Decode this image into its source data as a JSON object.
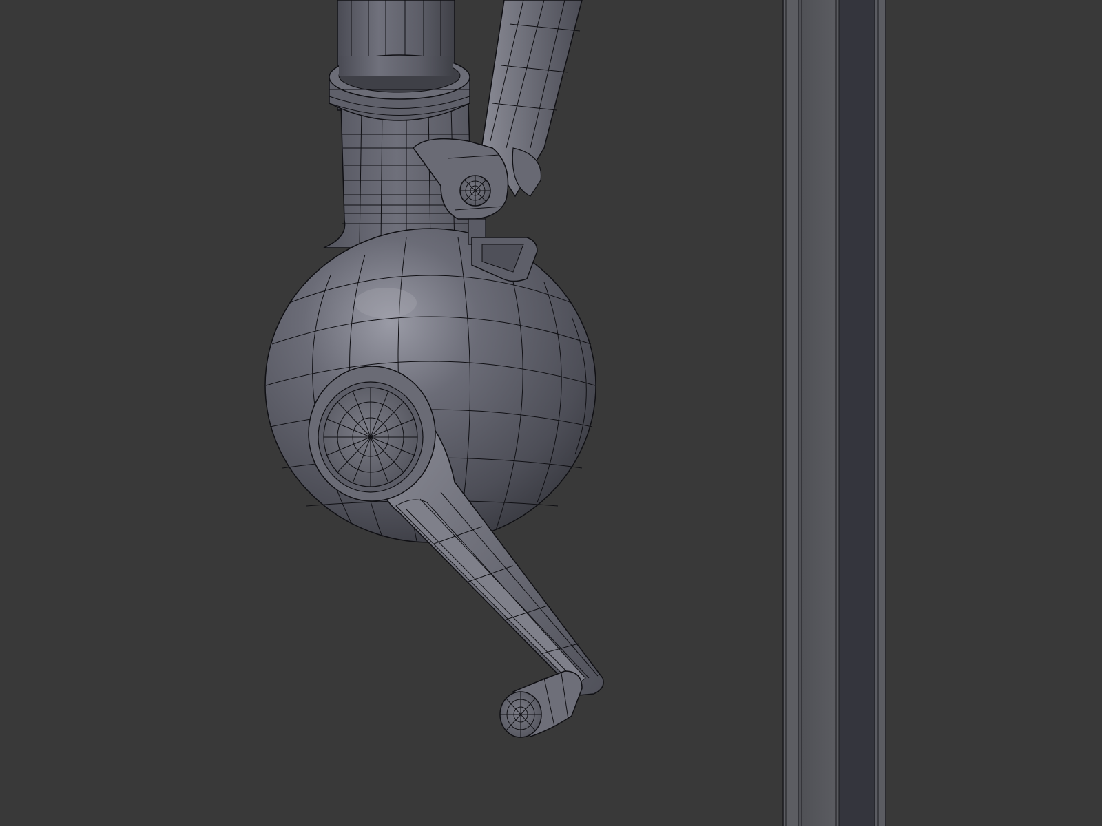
{
  "viewport": {
    "background": "#393939",
    "shading": "solid",
    "overlay": "wireframe"
  },
  "scene_objects": [
    {
      "name": "vertical-pipe",
      "icon": "mesh-cylinder"
    },
    {
      "name": "tension-rod",
      "icon": "mesh-cube"
    },
    {
      "name": "pipe-collar",
      "icon": "mesh-torus"
    },
    {
      "name": "hinge-bracket",
      "icon": "mesh-cube"
    },
    {
      "name": "hinge-pin",
      "icon": "mesh-circle"
    },
    {
      "name": "sphere-housing",
      "icon": "mesh-uvsphere"
    },
    {
      "name": "crank-hub",
      "icon": "mesh-cylinder"
    },
    {
      "name": "crank-arm",
      "icon": "mesh-cube"
    },
    {
      "name": "crank-handle",
      "icon": "mesh-cylinder"
    },
    {
      "name": "wall-post",
      "icon": "mesh-cube"
    }
  ],
  "colors": {
    "background": "#393939",
    "mesh_base": "#5a5b66",
    "mesh_light": "#7f808b",
    "mesh_dark": "#34353c",
    "wire": "#101014",
    "post_face": "#54555b",
    "post_dark": "#34353d"
  }
}
